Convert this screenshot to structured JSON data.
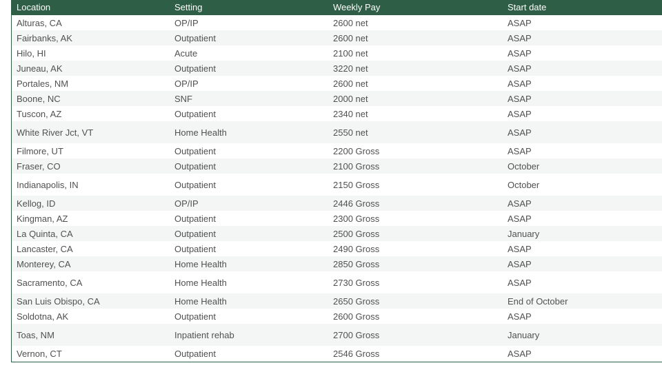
{
  "table": {
    "headers": [
      "Location",
      "Setting",
      "Weekly Pay",
      "Start date"
    ],
    "rows": [
      [
        "Alturas, CA",
        "OP/IP",
        "2600 net",
        "ASAP"
      ],
      [
        "Fairbanks, AK",
        "Outpatient",
        "2600 net",
        "ASAP"
      ],
      [
        "Hilo, HI",
        "Acute",
        "2100 net",
        "ASAP"
      ],
      [
        "Juneau, AK",
        "Outpatient",
        "3220 net",
        "ASAP"
      ],
      [
        "Portales, NM",
        "OP/IP",
        "2600 net",
        "ASAP"
      ],
      [
        "Boone, NC",
        "SNF",
        "2000 net",
        "ASAP"
      ],
      [
        "Tuscon, AZ",
        "Outpatient",
        "2340 net",
        "ASAP"
      ],
      [
        "White River Jct, VT",
        "Home Health",
        "2550 net",
        "ASAP"
      ],
      [
        "Filmore, UT",
        "Outpatient",
        "2200 Gross",
        "ASAP"
      ],
      [
        "Fraser, CO",
        "Outpatient",
        "2100 Gross",
        "October"
      ],
      [
        "Indianapolis, IN",
        "Outpatient",
        "2150 Gross",
        "October"
      ],
      [
        "Kellog, ID",
        "OP/IP",
        "2446 Gross",
        "ASAP"
      ],
      [
        "Kingman, AZ",
        "Outpatient",
        "2300 Gross",
        "ASAP"
      ],
      [
        "La Quinta, CA",
        "Outpatient",
        "2500 Gross",
        "January"
      ],
      [
        "Lancaster, CA",
        "Outpatient",
        "2490 Gross",
        "ASAP"
      ],
      [
        "Monterey, CA",
        "Home Health",
        "2850 Gross",
        "ASAP"
      ],
      [
        "Sacramento, CA",
        "Home Health",
        "2730 Gross",
        "ASAP"
      ],
      [
        "San Luis Obispo, CA",
        "Home Health",
        "2650 Gross",
        "End of October"
      ],
      [
        "Soldotna, AK",
        "Outpatient",
        "2600 Gross",
        "ASAP"
      ],
      [
        "Toas, NM",
        "Inpatient rehab",
        "2700 Gross",
        "January"
      ],
      [
        "Vernon, CT",
        "Outpatient",
        "2546 Gross",
        "ASAP"
      ]
    ]
  },
  "colors": {
    "header_bg": "#2f5e46",
    "header_text": "#ffffff",
    "row_alt_bg": "#f4f6f5",
    "text": "#505050"
  }
}
